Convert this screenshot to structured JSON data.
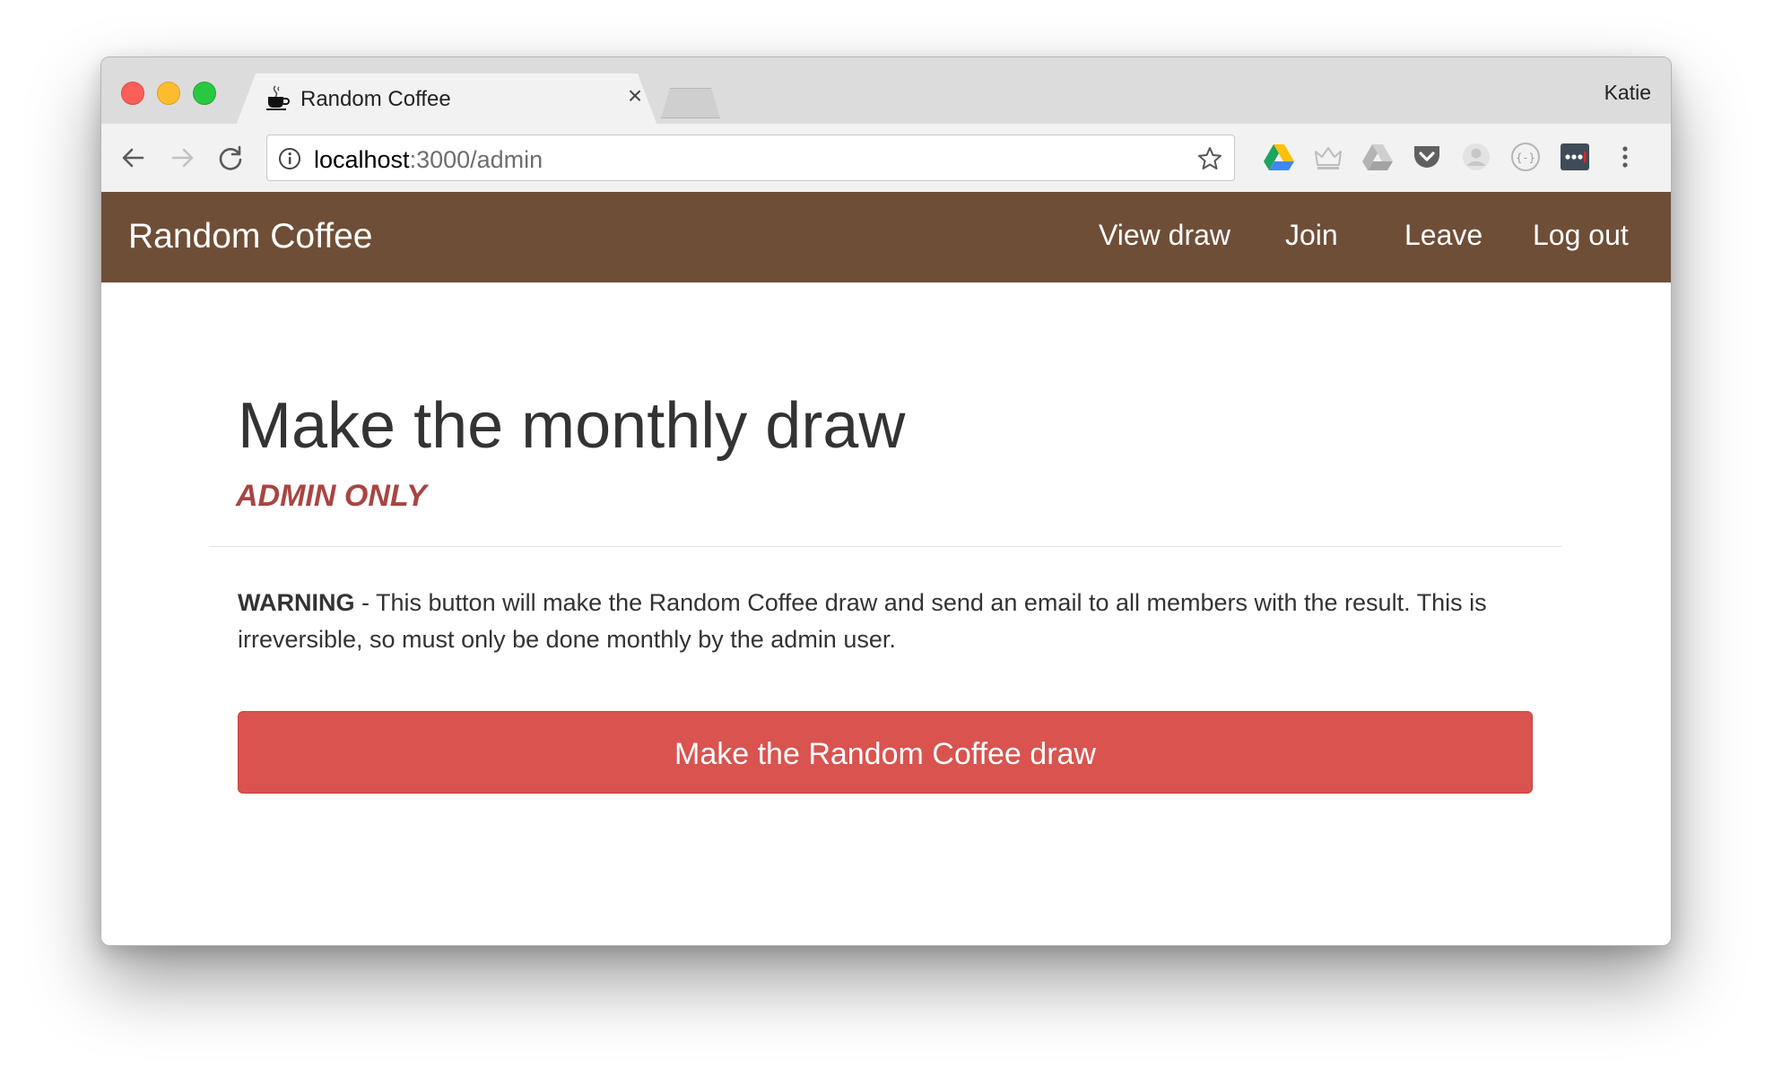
{
  "browser": {
    "tab_title": "Random Coffee",
    "tab_close_glyph": "×",
    "profile_name": "Katie",
    "url_host": "localhost",
    "url_rest": ":3000/admin",
    "icons": [
      "back-icon",
      "forward-icon",
      "reload-icon",
      "info-icon",
      "bookmark-star-icon",
      "google-drive-icon",
      "crown-extension-icon",
      "drive-grey-icon",
      "pocket-icon",
      "avatar-extension-icon",
      "json-viewer-icon",
      "lastpass-icon",
      "menu-icon"
    ]
  },
  "navbar": {
    "brand": "Random Coffee",
    "links": [
      "View draw",
      "Join",
      "Leave",
      "Log out"
    ],
    "background": "#6f4e37"
  },
  "main": {
    "heading": "Make the monthly draw",
    "subheading": "ADMIN ONLY",
    "warning_label": "WARNING",
    "warning_text": " - This button will make the Random Coffee draw and send an email to all members with the result. This is irreversible, so must only be done monthly by the admin user.",
    "button_label": "Make the Random Coffee draw",
    "button_color": "#d9534f",
    "subheading_color": "#a94442"
  }
}
